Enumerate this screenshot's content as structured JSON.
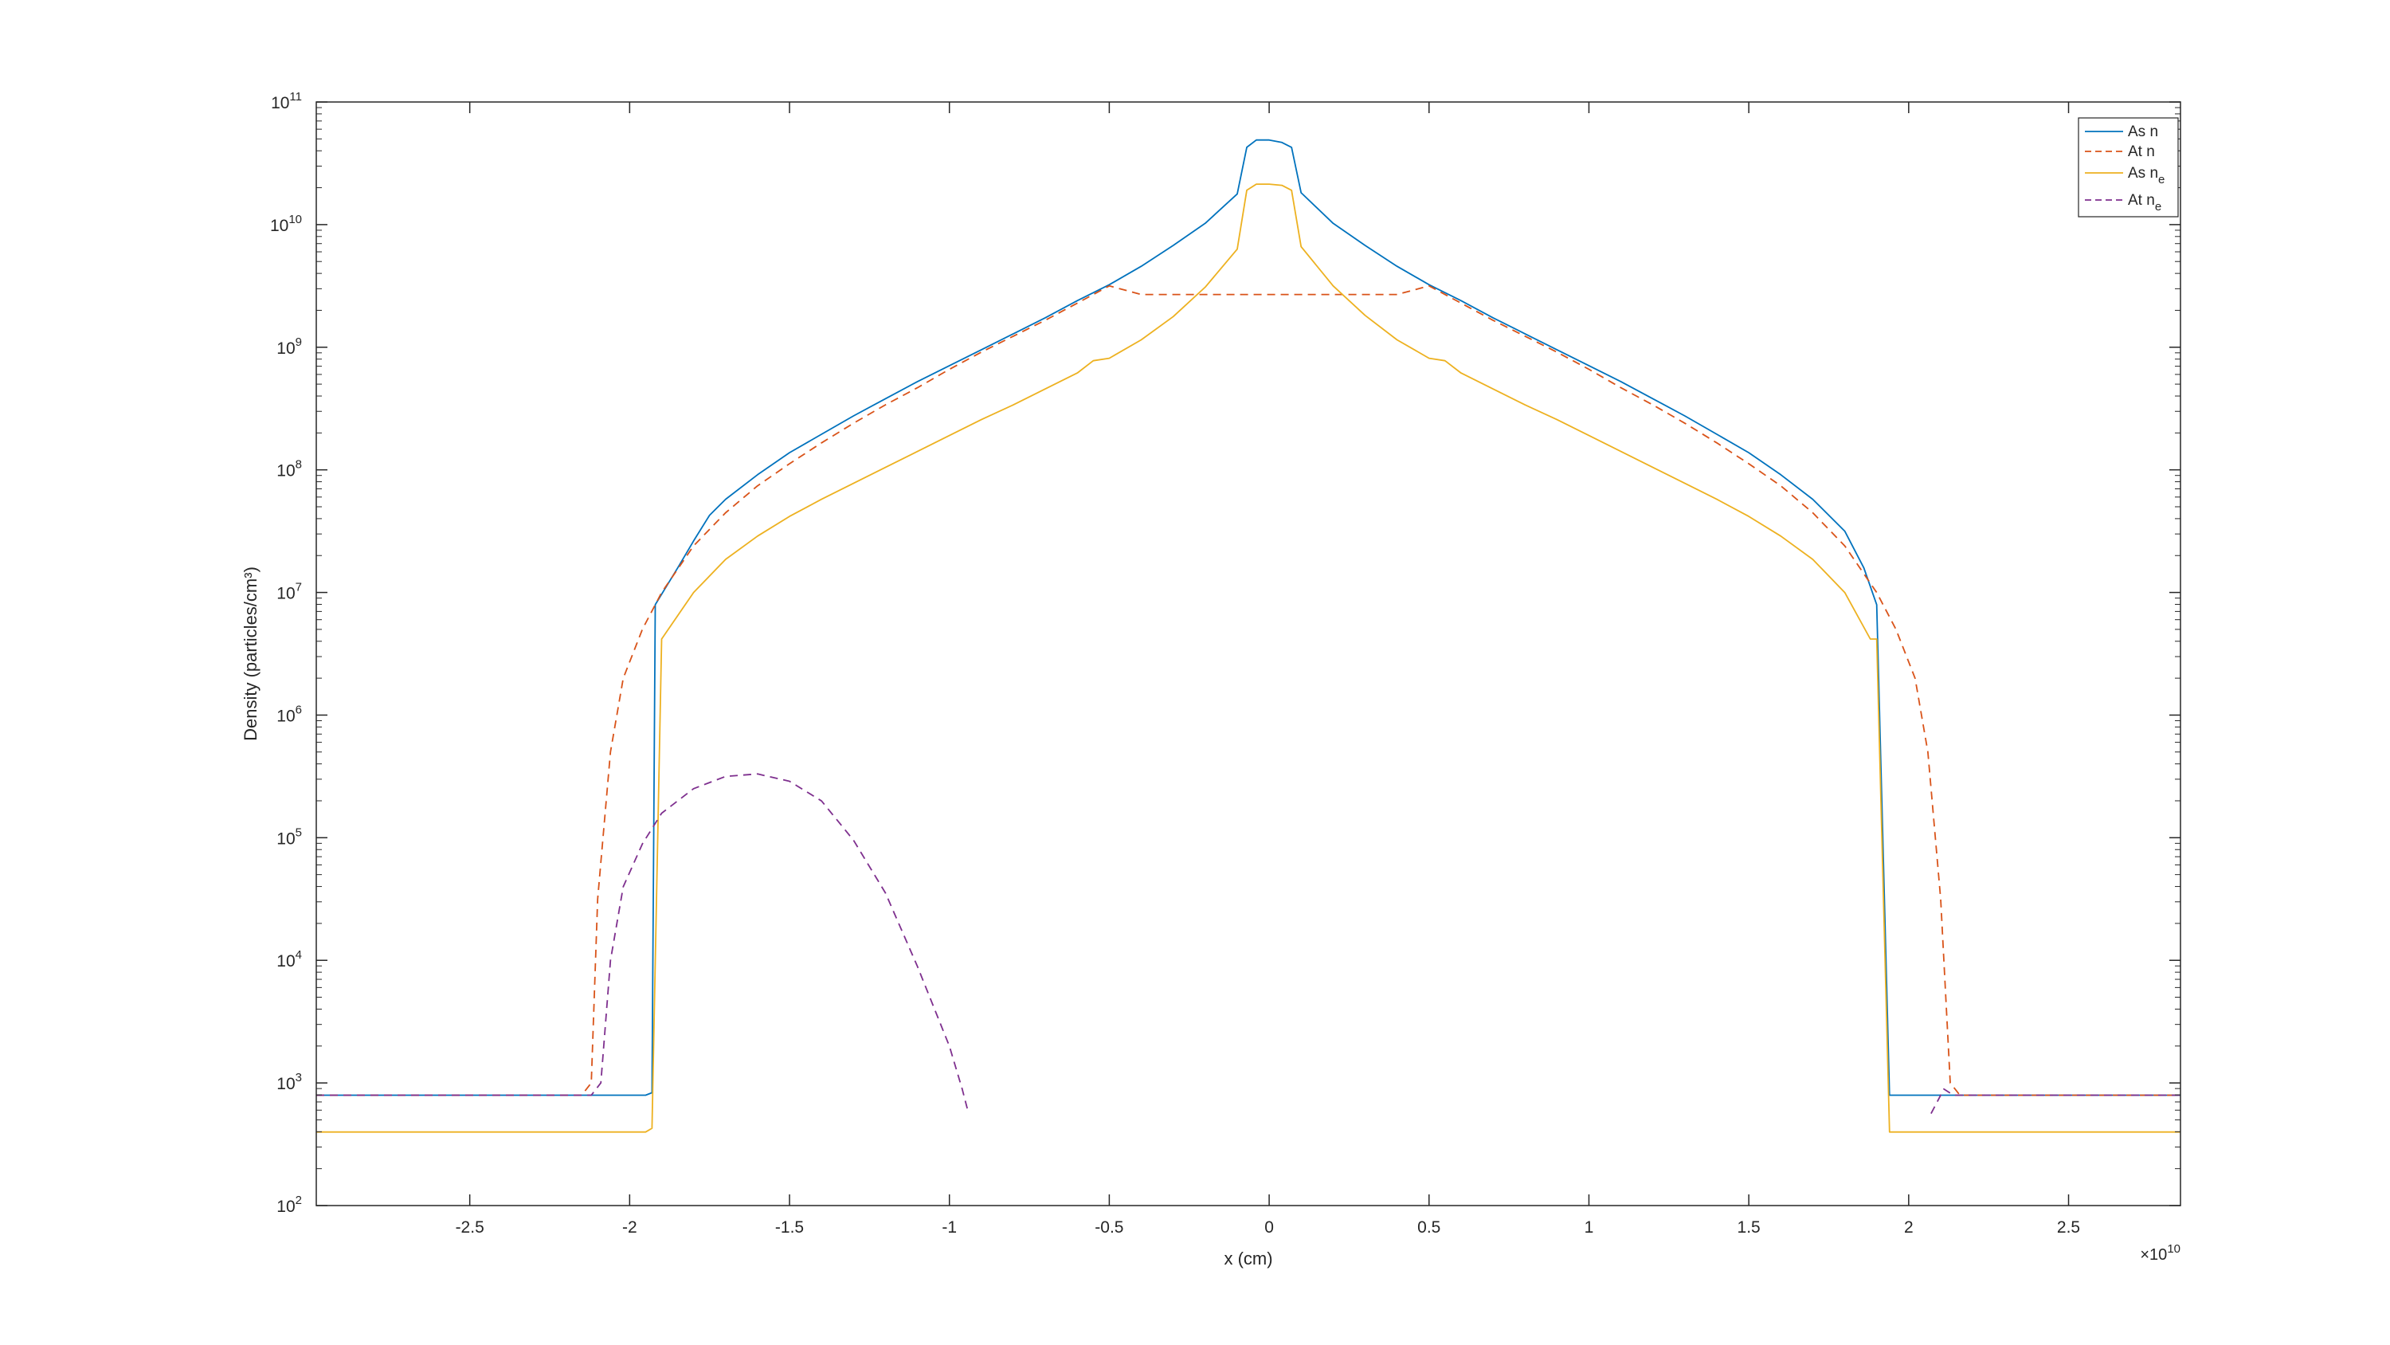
{
  "chart_data": {
    "type": "line",
    "xlabel": "x (cm)",
    "ylabel": "Density (particles/cm³)",
    "x_exponent_label": "×10",
    "x_exponent_power": "10",
    "y_scale": "log",
    "xlim": [
      -2.98,
      2.85
    ],
    "ylim": [
      100,
      100000000000
    ],
    "x_ticks": [
      -2.5,
      -2,
      -1.5,
      -1,
      -0.5,
      0,
      0.5,
      1,
      1.5,
      2,
      2.5
    ],
    "x_tick_labels": [
      "-2.5",
      "-2",
      "-1.5",
      "-1",
      "-0.5",
      "0",
      "0.5",
      "1",
      "1.5",
      "2",
      "2.5"
    ],
    "y_ticks": [
      2,
      3,
      4,
      5,
      6,
      7,
      8,
      9,
      10,
      11
    ],
    "y_tick_base": "10",
    "y_tick_powers": [
      "2",
      "3",
      "4",
      "5",
      "6",
      "7",
      "8",
      "9",
      "10",
      "11"
    ],
    "grid": false,
    "legend_position": "top-right",
    "series": [
      {
        "name": "As n",
        "legend_main": "As n",
        "legend_sub": "",
        "color": "#0072bd",
        "dash": "solid",
        "points": [
          [
            -2.98,
            2.9
          ],
          [
            -1.95,
            2.9
          ],
          [
            -1.93,
            2.92
          ],
          [
            -1.92,
            6.9
          ],
          [
            -1.85,
            7.2
          ],
          [
            -1.8,
            7.42
          ],
          [
            -1.75,
            7.63
          ],
          [
            -1.7,
            7.76
          ],
          [
            -1.6,
            7.96
          ],
          [
            -1.5,
            8.14
          ],
          [
            -1.4,
            8.29
          ],
          [
            -1.3,
            8.44
          ],
          [
            -1.2,
            8.58
          ],
          [
            -1.1,
            8.72
          ],
          [
            -1.0,
            8.85
          ],
          [
            -0.9,
            8.98
          ],
          [
            -0.8,
            9.11
          ],
          [
            -0.7,
            9.24
          ],
          [
            -0.6,
            9.38
          ],
          [
            -0.5,
            9.51
          ],
          [
            -0.4,
            9.66
          ],
          [
            -0.3,
            9.83
          ],
          [
            -0.2,
            10.01
          ],
          [
            -0.1,
            10.25
          ],
          [
            -0.07,
            10.63
          ],
          [
            -0.04,
            10.69
          ],
          [
            0.0,
            10.69
          ],
          [
            0.04,
            10.67
          ],
          [
            0.07,
            10.63
          ],
          [
            0.1,
            10.26
          ],
          [
            0.2,
            10.01
          ],
          [
            0.3,
            9.83
          ],
          [
            0.4,
            9.66
          ],
          [
            0.5,
            9.51
          ],
          [
            0.6,
            9.38
          ],
          [
            0.7,
            9.24
          ],
          [
            0.8,
            9.11
          ],
          [
            0.9,
            8.98
          ],
          [
            1.0,
            8.85
          ],
          [
            1.1,
            8.72
          ],
          [
            1.2,
            8.58
          ],
          [
            1.3,
            8.44
          ],
          [
            1.4,
            8.29
          ],
          [
            1.5,
            8.14
          ],
          [
            1.6,
            7.96
          ],
          [
            1.7,
            7.76
          ],
          [
            1.8,
            7.5
          ],
          [
            1.86,
            7.2
          ],
          [
            1.9,
            6.9
          ],
          [
            1.94,
            2.9
          ],
          [
            2.85,
            2.9
          ]
        ]
      },
      {
        "name": "At n",
        "legend_main": "At n",
        "legend_sub": "",
        "color": "#d95319",
        "dash": "10,7",
        "points": [
          [
            -2.98,
            2.9
          ],
          [
            -2.15,
            2.9
          ],
          [
            -2.12,
            3.0
          ],
          [
            -2.1,
            4.5
          ],
          [
            -2.06,
            5.7
          ],
          [
            -2.02,
            6.3
          ],
          [
            -1.96,
            6.7
          ],
          [
            -1.9,
            7.0
          ],
          [
            -1.8,
            7.38
          ],
          [
            -1.7,
            7.65
          ],
          [
            -1.6,
            7.87
          ],
          [
            -1.5,
            8.05
          ],
          [
            -1.4,
            8.22
          ],
          [
            -1.3,
            8.38
          ],
          [
            -1.2,
            8.53
          ],
          [
            -1.1,
            8.67
          ],
          [
            -1.0,
            8.82
          ],
          [
            -0.9,
            8.96
          ],
          [
            -0.8,
            9.09
          ],
          [
            -0.7,
            9.22
          ],
          [
            -0.6,
            9.36
          ],
          [
            -0.5,
            9.5
          ],
          [
            -0.4,
            9.43
          ],
          [
            0.4,
            9.43
          ],
          [
            0.5,
            9.5
          ],
          [
            0.6,
            9.36
          ],
          [
            0.7,
            9.22
          ],
          [
            0.8,
            9.09
          ],
          [
            0.9,
            8.96
          ],
          [
            1.0,
            8.82
          ],
          [
            1.1,
            8.67
          ],
          [
            1.2,
            8.53
          ],
          [
            1.3,
            8.38
          ],
          [
            1.4,
            8.22
          ],
          [
            1.5,
            8.05
          ],
          [
            1.6,
            7.87
          ],
          [
            1.7,
            7.65
          ],
          [
            1.8,
            7.38
          ],
          [
            1.9,
            7.0
          ],
          [
            1.96,
            6.7
          ],
          [
            2.02,
            6.3
          ],
          [
            2.06,
            5.7
          ],
          [
            2.1,
            4.5
          ],
          [
            2.13,
            3.0
          ],
          [
            2.16,
            2.9
          ],
          [
            2.85,
            2.9
          ]
        ]
      },
      {
        "name": "As ne",
        "legend_main": "As n",
        "legend_sub": "e",
        "color": "#edb120",
        "dash": "solid",
        "points": [
          [
            -2.98,
            2.6
          ],
          [
            -1.95,
            2.6
          ],
          [
            -1.93,
            2.63
          ],
          [
            -1.9,
            6.62
          ],
          [
            -1.8,
            7.0
          ],
          [
            -1.7,
            7.27
          ],
          [
            -1.6,
            7.46
          ],
          [
            -1.5,
            7.62
          ],
          [
            -1.4,
            7.76
          ],
          [
            -1.3,
            7.89
          ],
          [
            -1.2,
            8.02
          ],
          [
            -1.1,
            8.15
          ],
          [
            -1.0,
            8.28
          ],
          [
            -0.9,
            8.41
          ],
          [
            -0.8,
            8.53
          ],
          [
            -0.7,
            8.66
          ],
          [
            -0.6,
            8.79
          ],
          [
            -0.55,
            8.89
          ],
          [
            -0.5,
            8.91
          ],
          [
            -0.4,
            9.06
          ],
          [
            -0.3,
            9.25
          ],
          [
            -0.2,
            9.49
          ],
          [
            -0.1,
            9.8
          ],
          [
            -0.07,
            10.28
          ],
          [
            -0.04,
            10.33
          ],
          [
            0.0,
            10.33
          ],
          [
            0.04,
            10.32
          ],
          [
            0.07,
            10.28
          ],
          [
            0.1,
            9.82
          ],
          [
            0.2,
            9.5
          ],
          [
            0.3,
            9.26
          ],
          [
            0.4,
            9.06
          ],
          [
            0.5,
            8.91
          ],
          [
            0.55,
            8.89
          ],
          [
            0.6,
            8.79
          ],
          [
            0.7,
            8.66
          ],
          [
            0.8,
            8.53
          ],
          [
            0.9,
            8.41
          ],
          [
            1.0,
            8.28
          ],
          [
            1.1,
            8.15
          ],
          [
            1.2,
            8.02
          ],
          [
            1.3,
            7.89
          ],
          [
            1.4,
            7.76
          ],
          [
            1.5,
            7.62
          ],
          [
            1.6,
            7.46
          ],
          [
            1.7,
            7.27
          ],
          [
            1.8,
            7.0
          ],
          [
            1.88,
            6.62
          ],
          [
            1.9,
            6.62
          ],
          [
            1.94,
            2.6
          ],
          [
            2.85,
            2.6
          ]
        ]
      },
      {
        "name": "At ne",
        "legend_main": "At n",
        "legend_sub": "e",
        "color": "#7e2f8e",
        "dash": "10,7",
        "points": [
          [
            -2.98,
            2.9
          ],
          [
            -2.12,
            2.9
          ],
          [
            -2.09,
            3.0
          ],
          [
            -2.06,
            4.0
          ],
          [
            -2.02,
            4.6
          ],
          [
            -1.96,
            4.95
          ],
          [
            -1.9,
            5.2
          ],
          [
            -1.8,
            5.4
          ],
          [
            -1.7,
            5.5
          ],
          [
            -1.6,
            5.52
          ],
          [
            -1.5,
            5.46
          ],
          [
            -1.4,
            5.3
          ],
          [
            -1.3,
            4.98
          ],
          [
            -1.2,
            4.55
          ],
          [
            -1.1,
            3.95
          ],
          [
            -1.0,
            3.3
          ],
          [
            -0.96,
            2.95
          ],
          [
            -0.94,
            2.75
          ]
        ],
        "points2": [
          [
            2.07,
            2.75
          ],
          [
            2.11,
            2.95
          ],
          [
            2.14,
            2.9
          ],
          [
            2.85,
            2.9
          ]
        ]
      }
    ]
  }
}
